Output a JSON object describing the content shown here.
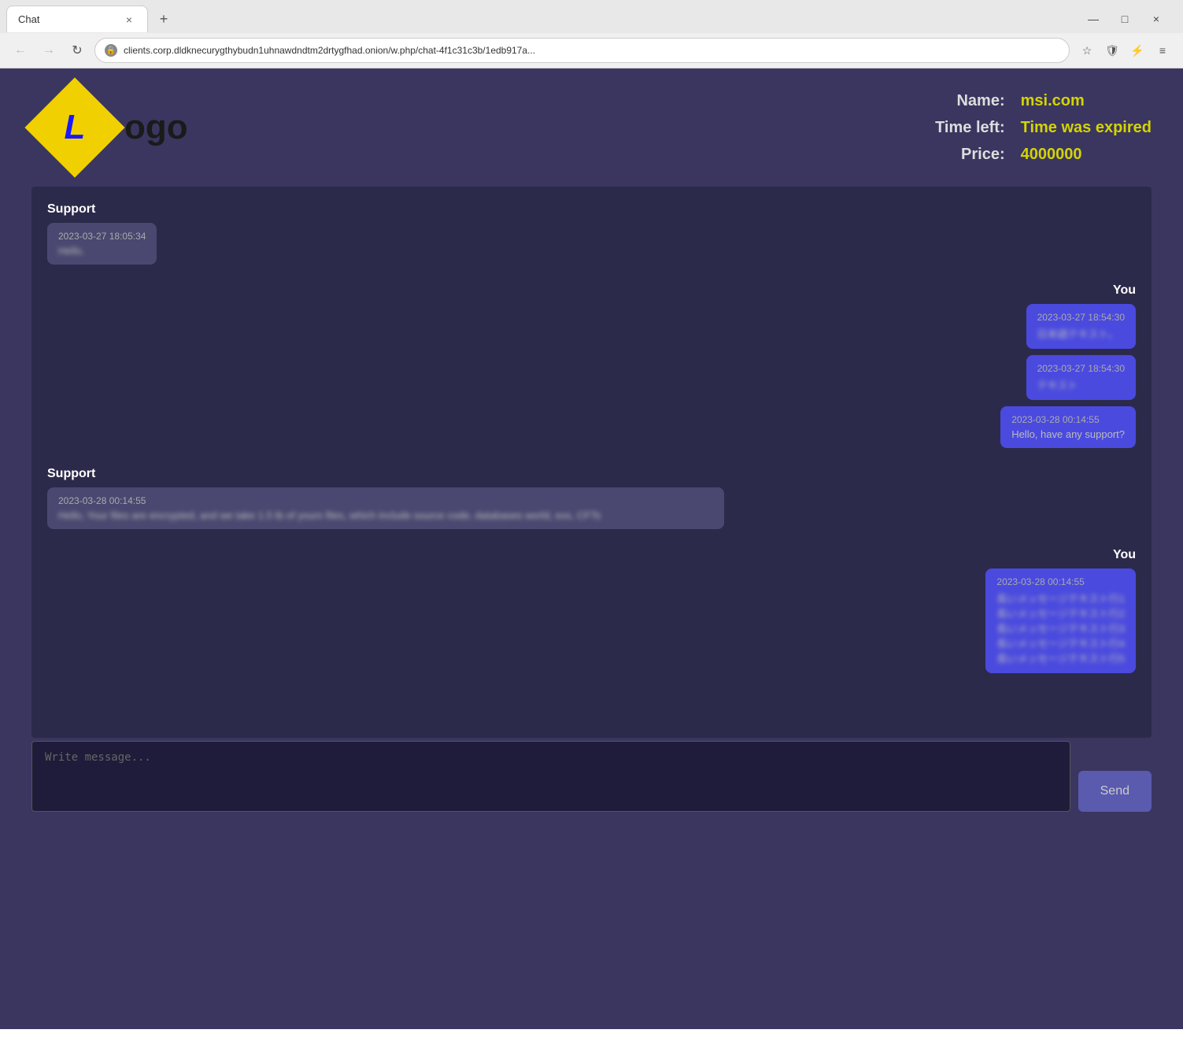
{
  "browser": {
    "tab_title": "Chat",
    "url": "clients.corp.dldknecurygthybudn1uhnawdndtm2drtygfhad.onion/w.php/chat-4f1c31c3b/1edb917a...",
    "tab_close": "×",
    "new_tab": "+",
    "win_minimize": "—",
    "win_maximize": "□",
    "win_close": "×",
    "nav_back": "←",
    "nav_forward": "→",
    "nav_reload": "↻",
    "nav_star": "☆",
    "nav_shield": "🛡",
    "nav_ext": "⚡",
    "nav_menu": "≡"
  },
  "header": {
    "logo_L": "L",
    "logo_rest": "ogo",
    "name_label": "Name:",
    "timeleft_label": "Time left:",
    "price_label": "Price:",
    "name_value": "msi.com",
    "timeleft_value": "Time was expired",
    "price_value": "4000000"
  },
  "chat": {
    "messages": [
      {
        "sender": "Support",
        "side": "left",
        "bubbles": [
          {
            "timestamp": "2023-03-27 18:05:34",
            "text": "Hello.",
            "blurred": true
          }
        ]
      },
      {
        "sender": "You",
        "side": "right",
        "bubbles": [
          {
            "timestamp": "2023-03-27 18:54:30",
            "text": "日本語テキスト",
            "blurred": true
          },
          {
            "timestamp": "2023-03-27 18:54:30",
            "text": "テキスト",
            "blurred": true
          },
          {
            "timestamp": "2023-03-28 00:14:55",
            "text": "Hello, have any support?",
            "blurred": false
          }
        ]
      },
      {
        "sender": "Support",
        "side": "left",
        "bubbles": [
          {
            "timestamp": "2023-03-28 00:14:55",
            "text": "Hello, Your files are encrypted, and we take 1.5 tb of yours files, which include source code, databases world, exs, CFTs",
            "blurred": true,
            "wide": true
          }
        ]
      },
      {
        "sender": "You",
        "side": "right",
        "bubbles": [
          {
            "timestamp": "2023-03-28 00:14:55",
            "text": "長いメッセージテキスト行1\n長いメッセージテキスト行2\n長いメッセージテキスト行3\n長いメッセージテキスト行4\n長いメッセージテキスト行5",
            "blurred": true
          }
        ]
      }
    ],
    "input_placeholder": "Write message...",
    "send_label": "Send"
  }
}
